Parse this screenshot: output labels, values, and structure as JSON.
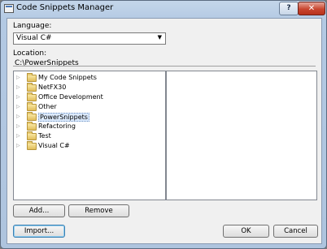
{
  "window": {
    "title": "Code Snippets Manager"
  },
  "titlebar": {
    "help_label": "?",
    "close_label": "✕"
  },
  "language": {
    "label": "Language:",
    "value": "Visual C#"
  },
  "location": {
    "label": "Location:",
    "path": "C:\\PowerSnippets"
  },
  "tree": {
    "items": [
      {
        "label": "My Code Snippets"
      },
      {
        "label": "NetFX30"
      },
      {
        "label": "Office Development"
      },
      {
        "label": "Other"
      },
      {
        "label": "PowerSnippets",
        "selected": true
      },
      {
        "label": "Refactoring"
      },
      {
        "label": "Test"
      },
      {
        "label": "Visual C#"
      }
    ]
  },
  "buttons": {
    "add": "Add...",
    "remove": "Remove",
    "import": "Import...",
    "ok": "OK",
    "cancel": "Cancel"
  }
}
